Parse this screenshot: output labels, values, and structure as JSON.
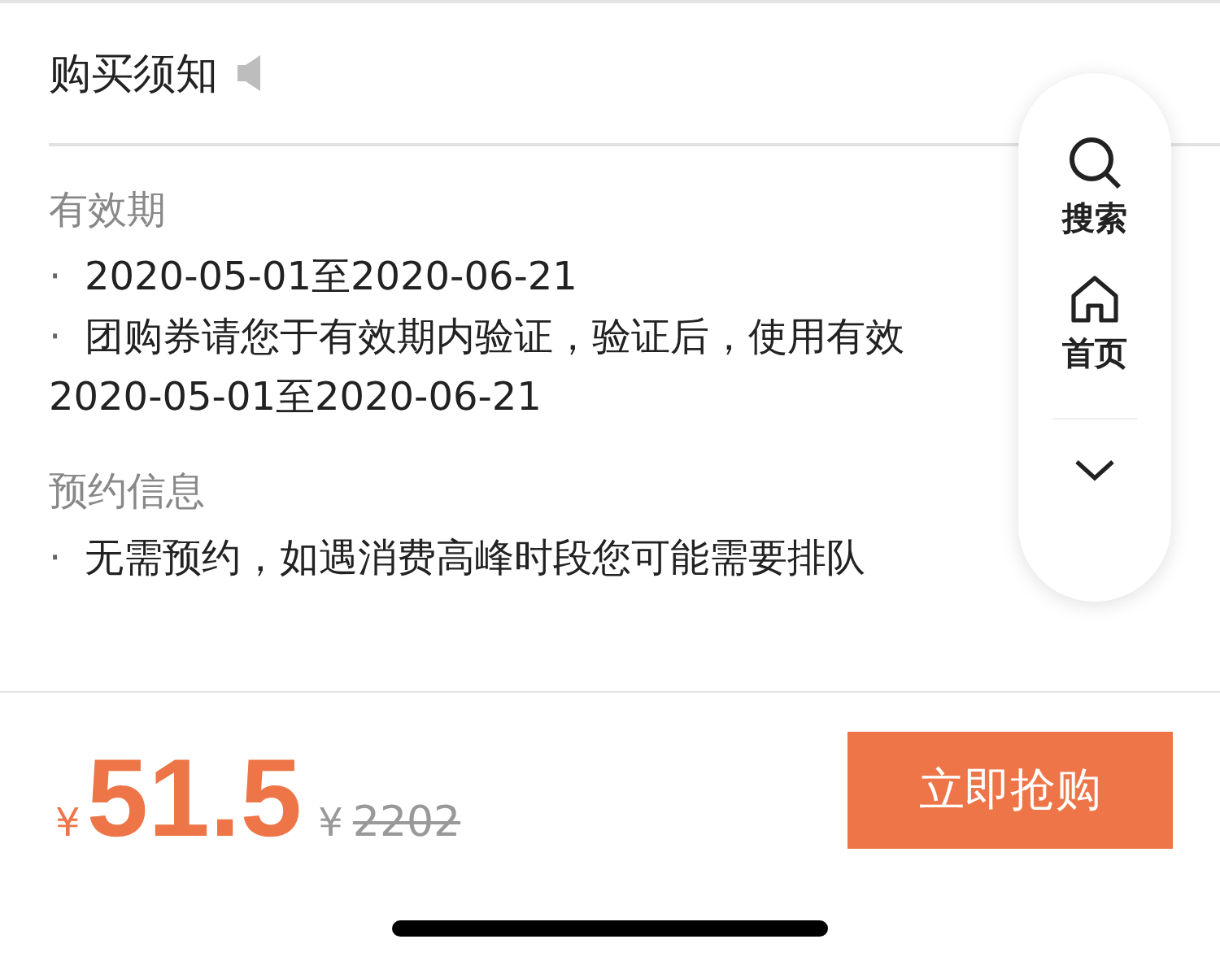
{
  "notice": {
    "title": "购买须知",
    "sections": [
      {
        "heading": "有效期",
        "items": [
          {
            "bullet": "·",
            "lines": [
              "2020-05-01至2020-06-21"
            ]
          },
          {
            "bullet": "·",
            "lines": [
              "团购券请您于有效期内验证，验证后，使用有效",
              "2020-05-01至2020-06-21"
            ]
          }
        ]
      },
      {
        "heading": "预约信息",
        "items": [
          {
            "bullet": "·",
            "lines": [
              "无需预约，如遇消费高峰时段您可能需要排队"
            ]
          }
        ]
      }
    ]
  },
  "float_nav": {
    "items": [
      {
        "kind": "search",
        "label": "搜索"
      },
      {
        "kind": "home",
        "label": "首页"
      },
      {
        "kind": "collapse"
      }
    ]
  },
  "buy_bar": {
    "currency": "¥",
    "price": "51.5",
    "original_currency": "¥",
    "original_price": "2202",
    "button": "立即抢购"
  }
}
